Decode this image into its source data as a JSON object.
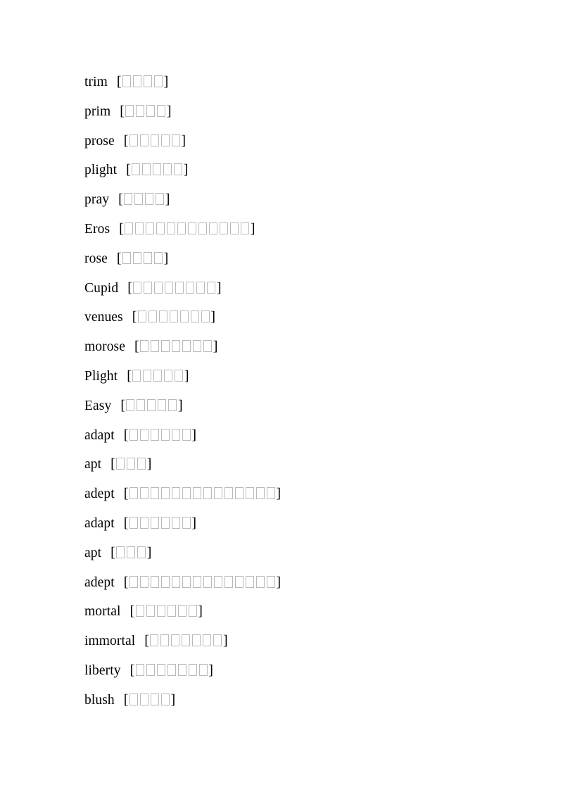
{
  "document": {
    "page_background": "#ffffff",
    "text_color": "#000000",
    "tofu_color": "#b9b9b9",
    "bracket_open": "[",
    "bracket_close": "]",
    "entries": [
      {
        "word": "trim",
        "gloss_boxes": 4
      },
      {
        "word": "prim",
        "gloss_boxes": 4
      },
      {
        "word": "prose",
        "gloss_boxes": 5
      },
      {
        "word": "plight",
        "gloss_boxes": 5
      },
      {
        "word": "pray",
        "gloss_boxes": 4
      },
      {
        "word": "Eros",
        "gloss_boxes": 12
      },
      {
        "word": "rose",
        "gloss_boxes": 4
      },
      {
        "word": "Cupid",
        "gloss_boxes": 8
      },
      {
        "word": "venues",
        "gloss_boxes": 7
      },
      {
        "word": "morose",
        "gloss_boxes": 7
      },
      {
        "word": "Plight",
        "gloss_boxes": 5
      },
      {
        "word": "Easy",
        "gloss_boxes": 5
      },
      {
        "word": "adapt",
        "gloss_boxes": 6
      },
      {
        "word": "apt",
        "gloss_boxes": 3
      },
      {
        "word": "adept",
        "gloss_boxes": 14
      },
      {
        "word": "adapt",
        "gloss_boxes": 6
      },
      {
        "word": "apt",
        "gloss_boxes": 3
      },
      {
        "word": "adept",
        "gloss_boxes": 14
      },
      {
        "word": "mortal",
        "gloss_boxes": 6
      },
      {
        "word": "immortal",
        "gloss_boxes": 7
      },
      {
        "word": "liberty",
        "gloss_boxes": 7
      },
      {
        "word": "blush",
        "gloss_boxes": 4
      }
    ]
  }
}
